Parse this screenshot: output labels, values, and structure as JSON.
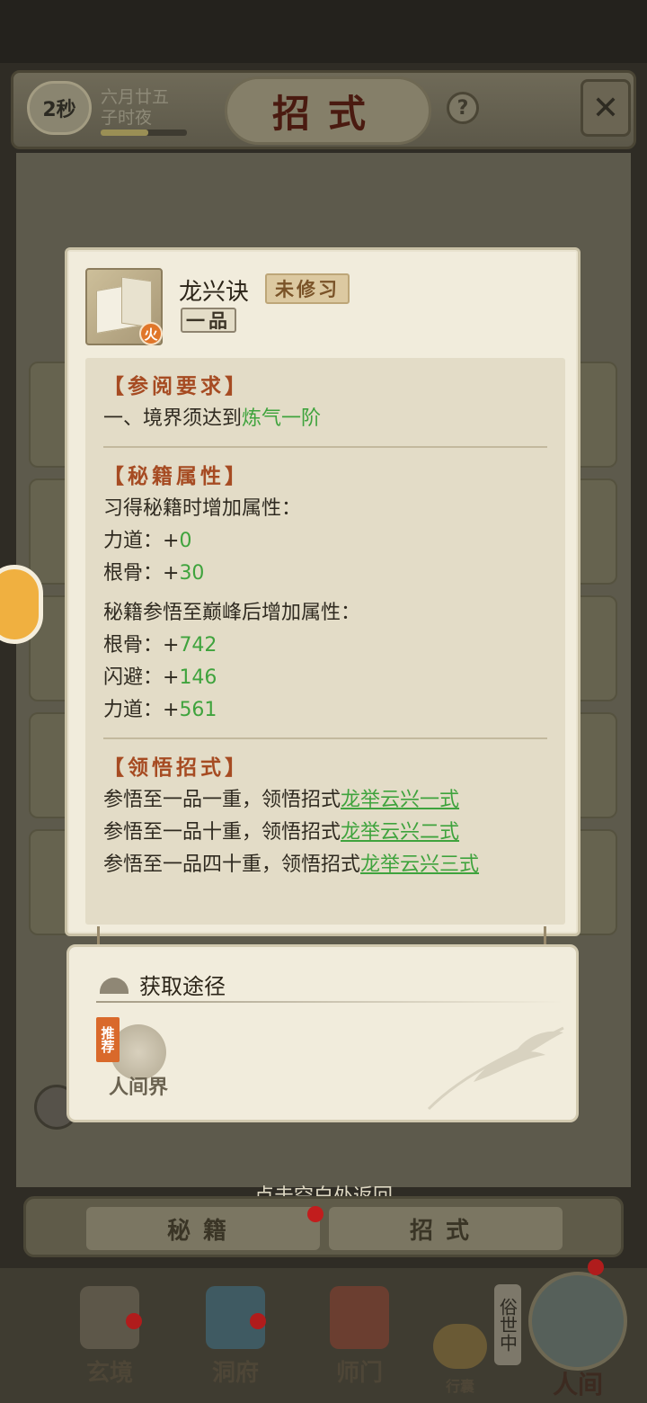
{
  "header": {
    "timer": "2秒",
    "date_line1": "六月廿五",
    "date_line2": "子时夜",
    "time_progress": 0.55,
    "title": "招式",
    "help_label": "?"
  },
  "skill": {
    "name": "龙兴诀",
    "status": "未修习",
    "grade": "一品",
    "element": "火",
    "requirement": {
      "title": "【参阅要求】",
      "line_prefix": "一、境界须达到",
      "line_value": "炼气一阶"
    },
    "attributes": {
      "title": "【秘籍属性】",
      "learn_header": "习得秘籍时增加属性：",
      "learn_stats": [
        {
          "label": "力道：+",
          "value": "0"
        },
        {
          "label": "根骨：+",
          "value": "30"
        }
      ],
      "peak_header": "秘籍参悟至巅峰后增加属性：",
      "peak_stats": [
        {
          "label": "根骨：+",
          "value": "742"
        },
        {
          "label": "闪避：+",
          "value": "146"
        },
        {
          "label": "力道：+",
          "value": "561"
        }
      ]
    },
    "moves": {
      "title": "【领悟招式】",
      "items": [
        {
          "prefix": "参悟至一品一重，领悟招式",
          "move": "龙举云兴一式"
        },
        {
          "prefix": "参悟至一品十重，领悟招式",
          "move": "龙举云兴二式"
        },
        {
          "prefix": "参悟至一品四十重，领悟招式",
          "move": "龙举云兴三式"
        }
      ]
    }
  },
  "acquire": {
    "title": "获取途径",
    "source_tag": "推荐",
    "source_label": "人间界"
  },
  "return_hint": "点击空白处返回",
  "tabs": [
    "秘籍",
    "招式"
  ],
  "nav": {
    "items": [
      "玄境",
      "洞府",
      "师门",
      "行囊"
    ],
    "world_tag": "俗世中",
    "world_label": "人间"
  },
  "colors": {
    "green": "#3fa33d",
    "section_title": "#a64b22",
    "badge_red": "#b01c1c"
  }
}
